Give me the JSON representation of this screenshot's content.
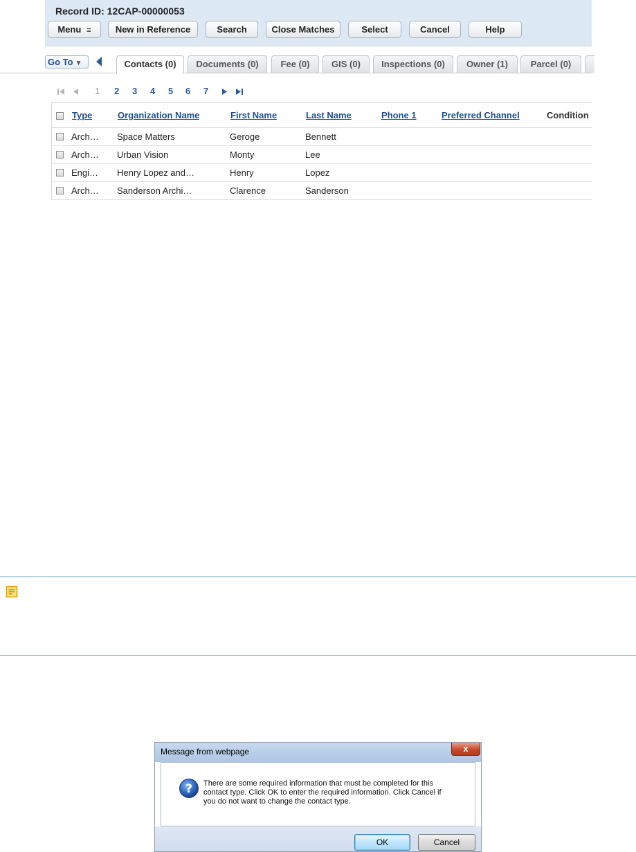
{
  "record": {
    "label": "Record ID: 12CAP-00000053"
  },
  "toolbar": {
    "menu": "Menu",
    "new_in_reference": "New in Reference",
    "search": "Search",
    "close_matches": "Close Matches",
    "select": "Select",
    "cancel": "Cancel",
    "help": "Help"
  },
  "tabs": {
    "goto": "Go To",
    "items": [
      "Contacts (0)",
      "Documents (0)",
      "Fee (0)",
      "GIS (0)",
      "Inspections (0)",
      "Owner (1)",
      "Parcel (0)"
    ],
    "active_index": 0
  },
  "pager": {
    "pages": [
      "1",
      "2",
      "3",
      "4",
      "5",
      "6",
      "7"
    ],
    "current": "1"
  },
  "grid": {
    "columns": [
      "Type",
      "Organization Name",
      "First Name",
      "Last Name",
      "Phone 1",
      "Preferred Channel",
      "Condition"
    ],
    "rows": [
      [
        "Arch…",
        "Space Matters",
        "Geroge",
        "Bennett"
      ],
      [
        "Arch…",
        "Urban Vision",
        "Monty",
        "Lee"
      ],
      [
        "Engi…",
        "Henry Lopez and…",
        "Henry",
        "Lopez"
      ],
      [
        "Arch…",
        "Sanderson Archi…",
        "Clarence",
        "Sanderson"
      ]
    ]
  },
  "dialog": {
    "title": "Message from webpage",
    "close": "x",
    "message_lines": [
      "There are some required information that must be completed for this",
      "contact type. Click OK to enter the required information. Click Cancel if",
      "you do not want to change the contact type."
    ],
    "ok": "OK",
    "cancel": "Cancel"
  },
  "colors": {
    "panel": "#dde8f5",
    "link": "#1f4e8c",
    "note_rule": "#5aa3b8",
    "note_icon": "#f2b705"
  }
}
